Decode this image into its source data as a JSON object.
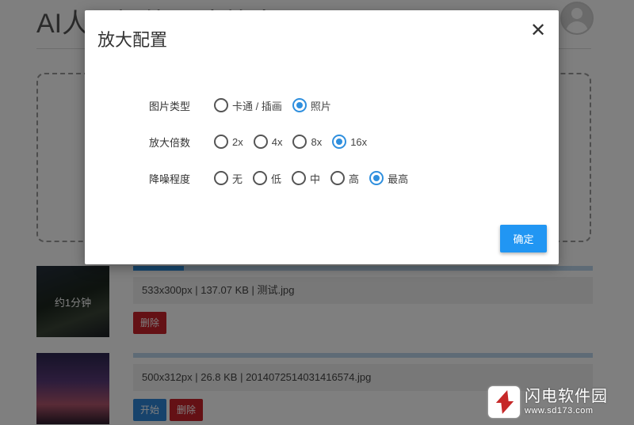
{
  "page": {
    "title": "AI人工智能图片放大"
  },
  "items": [
    {
      "eta": "约1分钟",
      "progress": 0.11,
      "info": "533x300px | 137.07 KB | 测试.jpg",
      "delete_label": "删除"
    },
    {
      "progress": 0,
      "info": "500x312px | 26.8 KB | 20140725140314165​74.jpg",
      "start_label": "开始",
      "delete_label": "删除"
    }
  ],
  "watermark": {
    "name": "闪电软件园",
    "url": "www.sd173.com"
  },
  "modal": {
    "title": "放大配置",
    "close_glyph": "✕",
    "rows": [
      {
        "label": "图片类型",
        "options": [
          {
            "label": "卡通 / 插画",
            "checked": false
          },
          {
            "label": "照片",
            "checked": true
          }
        ]
      },
      {
        "label": "放大倍数",
        "options": [
          {
            "label": "2x",
            "checked": false
          },
          {
            "label": "4x",
            "checked": false
          },
          {
            "label": "8x",
            "checked": false
          },
          {
            "label": "16x",
            "checked": true
          }
        ]
      },
      {
        "label": "降噪程度",
        "options": [
          {
            "label": "无",
            "checked": false
          },
          {
            "label": "低",
            "checked": false
          },
          {
            "label": "中",
            "checked": false
          },
          {
            "label": "高",
            "checked": false
          },
          {
            "label": "最高",
            "checked": true
          }
        ]
      }
    ],
    "confirm_label": "确定"
  },
  "colors": {
    "accent": "#2196f3",
    "danger": "#c8232b",
    "start": "#2f86d8"
  }
}
